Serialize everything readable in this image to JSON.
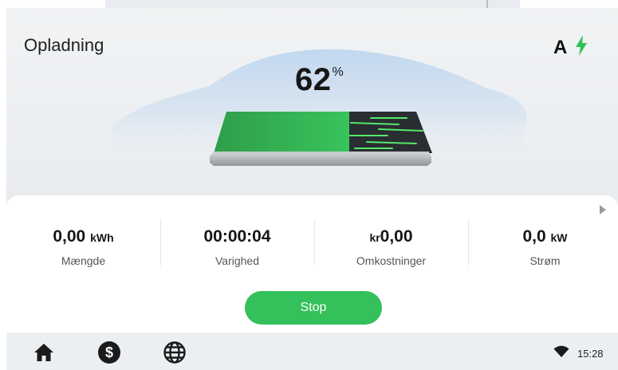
{
  "header": {
    "title": "Opladning",
    "mode_letter": "A",
    "charging_icon": "lightning-bolt-icon"
  },
  "battery": {
    "percent": "62",
    "percent_symbol": "%",
    "level": 0.62
  },
  "stats": [
    {
      "value": "0,00",
      "unit": "kWh",
      "label": "Mængde"
    },
    {
      "value": "00:00:04",
      "unit": "",
      "label": "Varighed"
    },
    {
      "prefix": "kr",
      "value": "0,00",
      "label": "Omkostninger"
    },
    {
      "value": "0,0",
      "unit": "kW",
      "label": "Strøm"
    }
  ],
  "actions": {
    "stop_label": "Stop"
  },
  "nav": {
    "items": [
      "home-icon",
      "dollar-icon",
      "globe-icon"
    ]
  },
  "status_bar": {
    "wifi_icon": "wifi-icon",
    "time": "15:28"
  },
  "colors": {
    "accent": "#34c05a",
    "background": "#eceff2"
  }
}
